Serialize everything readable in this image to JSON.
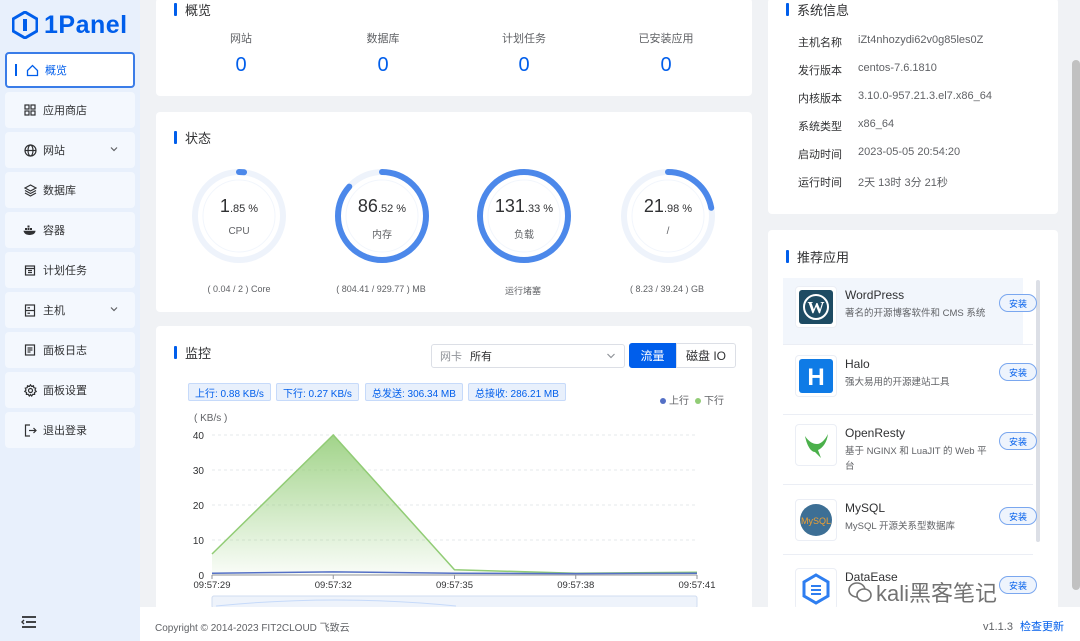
{
  "brand": {
    "name": "1Panel",
    "color": "#005eeb"
  },
  "sidebar": {
    "items": [
      {
        "label": "概览",
        "icon": "home-icon",
        "active": true
      },
      {
        "label": "应用商店",
        "icon": "grid-icon"
      },
      {
        "label": "网站",
        "icon": "globe-icon",
        "expandable": true
      },
      {
        "label": "数据库",
        "icon": "database-icon"
      },
      {
        "label": "容器",
        "icon": "docker-icon"
      },
      {
        "label": "计划任务",
        "icon": "calendar-icon"
      },
      {
        "label": "主机",
        "icon": "server-icon",
        "expandable": true
      },
      {
        "label": "面板日志",
        "icon": "log-icon"
      },
      {
        "label": "面板设置",
        "icon": "gear-icon"
      },
      {
        "label": "退出登录",
        "icon": "logout-icon"
      }
    ]
  },
  "overview": {
    "title": "概览",
    "items": [
      {
        "label": "网站",
        "value": "0"
      },
      {
        "label": "数据库",
        "value": "0"
      },
      {
        "label": "计划任务",
        "value": "0"
      },
      {
        "label": "已安装应用",
        "value": "0"
      }
    ]
  },
  "status": {
    "title": "状态",
    "gauges": [
      {
        "int": "1",
        "dec": ".85",
        "unit": " %",
        "label": "CPU",
        "sub": "( 0.04 / 2 ) Core",
        "percent": 1.85
      },
      {
        "int": "86",
        "dec": ".52",
        "unit": " %",
        "label": "内存",
        "sub": "( 804.41 / 929.77 ) MB",
        "percent": 86.52
      },
      {
        "int": "131",
        "dec": ".33",
        "unit": " %",
        "label": "负载",
        "sub": "运行堵塞",
        "percent": 100
      },
      {
        "int": "21",
        "dec": ".98",
        "unit": " %",
        "label": "/",
        "sub": "( 8.23 / 39.24 ) GB",
        "percent": 21.98
      }
    ]
  },
  "monitor": {
    "title": "监控",
    "nic_label": "网卡",
    "nic_value": "所有",
    "seg_traffic": "流量",
    "seg_disk": "磁盘 IO",
    "tags": [
      "上行: 0.88 KB/s",
      "下行: 0.27 KB/s",
      "总发送: 306.34 MB",
      "总接收: 286.21 MB"
    ],
    "legend_up": "上行",
    "legend_down": "下行"
  },
  "chart_data": {
    "type": "area",
    "ylabel": "( KB/s )",
    "ylim": [
      0,
      40
    ],
    "yticks": [
      "0",
      "10",
      "20",
      "30",
      "40"
    ],
    "x": [
      "09:57:29",
      "09:57:32",
      "09:57:35",
      "09:57:38",
      "09:57:41"
    ],
    "series": [
      {
        "name": "上行",
        "color": "#5470c6",
        "values": [
          0.5,
          0.9,
          0.5,
          0.4,
          0.5
        ]
      },
      {
        "name": "下行",
        "color": "#91cc75",
        "values": [
          6,
          40,
          1.5,
          0.5,
          0.8
        ]
      }
    ]
  },
  "sysinfo": {
    "title": "系统信息",
    "rows": [
      {
        "key": "主机名称",
        "value": "iZt4nhozydi62v0g85les0Z"
      },
      {
        "key": "发行版本",
        "value": "centos-7.6.1810"
      },
      {
        "key": "内核版本",
        "value": "3.10.0-957.21.3.el7.x86_64"
      },
      {
        "key": "系统类型",
        "value": "x86_64"
      },
      {
        "key": "启动时间",
        "value": "2023-05-05 20:54:20"
      },
      {
        "key": "运行时间",
        "value": "2天 13时 3分 21秒"
      }
    ]
  },
  "apps": {
    "title": "推荐应用",
    "install_label": "安装",
    "items": [
      {
        "name": "WordPress",
        "desc": "著名的开源博客软件和 CMS 系统",
        "icon": "wordpress-icon"
      },
      {
        "name": "Halo",
        "desc": "强大易用的开源建站工具",
        "icon": "halo-icon"
      },
      {
        "name": "OpenResty",
        "desc": "基于 NGINX 和 LuaJIT 的 Web 平台",
        "icon": "openresty-icon"
      },
      {
        "name": "MySQL",
        "desc": "MySQL 开源关系型数据库",
        "icon": "mysql-icon"
      },
      {
        "name": "DataEase",
        "desc": "",
        "icon": "dataease-icon"
      }
    ]
  },
  "footer": {
    "copyright": "Copyright © 2014-2023 FIT2CLOUD 飞致云",
    "version": "v1.1.3",
    "update": "检查更新"
  },
  "watermark": "kali黑客笔记"
}
